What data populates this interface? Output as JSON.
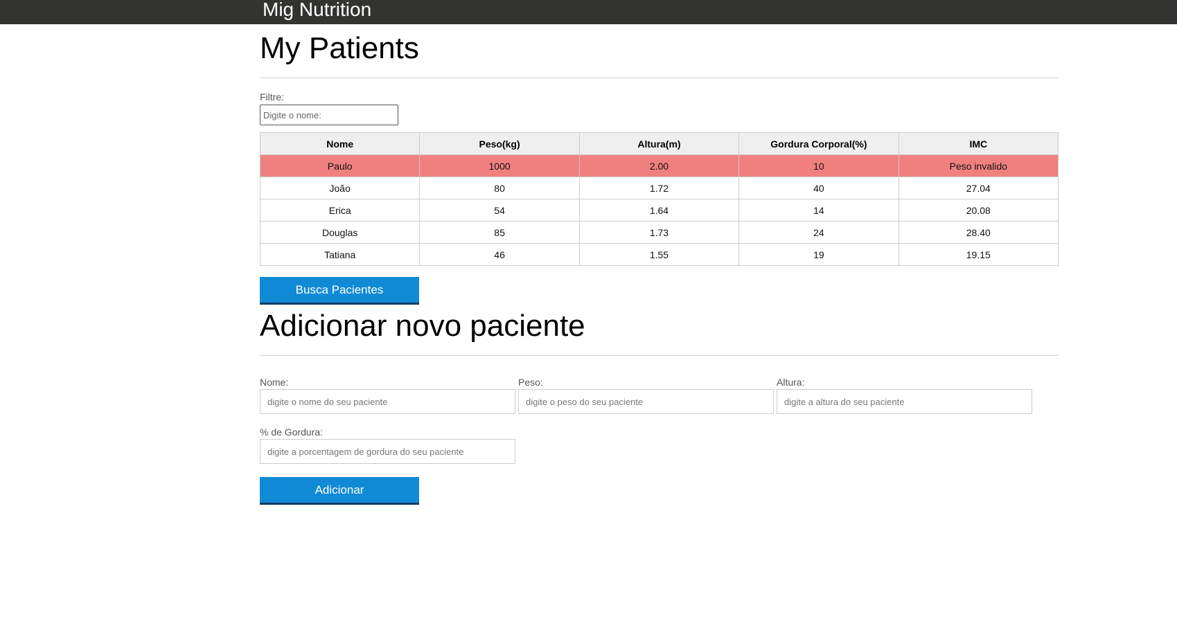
{
  "header": {
    "brand": "Mig Nutrition"
  },
  "patients_section": {
    "title": "My Patients",
    "filter_label": "Filtre:",
    "filter_placeholder": "Digite o nome:",
    "columns": [
      "Nome",
      "Peso(kg)",
      "Altura(m)",
      "Gordura Corporal(%)",
      "IMC"
    ],
    "rows": [
      {
        "nome": "Paulo",
        "peso": "1000",
        "altura": "2.00",
        "gordura": "10",
        "imc": "Peso invalido",
        "invalid": true
      },
      {
        "nome": "João",
        "peso": "80",
        "altura": "1.72",
        "gordura": "40",
        "imc": "27.04",
        "invalid": false
      },
      {
        "nome": "Erica",
        "peso": "54",
        "altura": "1.64",
        "gordura": "14",
        "imc": "20.08",
        "invalid": false
      },
      {
        "nome": "Douglas",
        "peso": "85",
        "altura": "1.73",
        "gordura": "24",
        "imc": "28.40",
        "invalid": false
      },
      {
        "nome": "Tatiana",
        "peso": "46",
        "altura": "1.55",
        "gordura": "19",
        "imc": "19.15",
        "invalid": false
      }
    ],
    "search_button": "Busca Pacientes"
  },
  "add_section": {
    "title": "Adicionar novo paciente",
    "nome_label": "Nome:",
    "nome_placeholder": "digite o nome do seu paciente",
    "peso_label": "Peso:",
    "peso_placeholder": "digite o peso do seu paciente",
    "altura_label": "Altura:",
    "altura_placeholder": "digite a altura do seu paciente",
    "gordura_label": "% de Gordura:",
    "gordura_placeholder": "digite a porcentagem de gordura do seu paciente",
    "add_button": "Adicionar"
  },
  "colors": {
    "topbar": "#333432",
    "button": "#118ad6",
    "invalid_row": "#f08080"
  }
}
